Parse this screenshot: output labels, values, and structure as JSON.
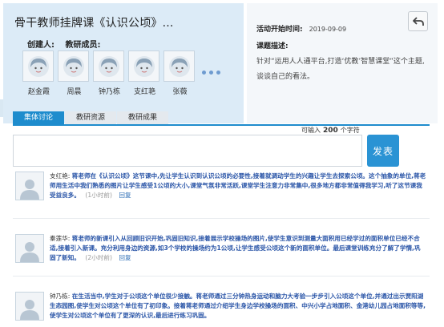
{
  "activity": {
    "title": "骨干教师挂牌课《认识公顷》...",
    "creator_label": "创建人:",
    "members_label": "教研成员:",
    "members": [
      {
        "name": "赵金霞"
      },
      {
        "name": "周晨"
      },
      {
        "name": "钟乃栋"
      },
      {
        "name": "支红艳"
      },
      {
        "name": "张薇"
      }
    ]
  },
  "info": {
    "time_label": "活动开始时间:",
    "time_value": "2019-09-09",
    "desc_label": "课题描述:",
    "description": "针对“运用人人通平台,打造‘优教’智慧课堂”这个主题,谈谈自己的看法。"
  },
  "tabs": [
    {
      "label": "集体讨论",
      "active": true
    },
    {
      "label": "教研资源",
      "active": false
    },
    {
      "label": "教研成果",
      "active": false
    }
  ],
  "composer": {
    "counter_prefix": "可输入",
    "counter_value": "200",
    "counter_suffix": "个字符",
    "send_label": "发表"
  },
  "posts": [
    {
      "author": "支红艳:",
      "body": "蒋老师在《认识公顷》这节课中,先让学生认识到认识公顷的必要性,接着就调动学生的兴趣让学生去探索公顷。这个抽象的单位,蒋老师用生活中我们熟悉的图片让学生感受1公顷的大小,课堂气氛非常活跃,课堂学生注意力非常集中,很多地方都非常值得我学习,听了这节课我受益良多。",
      "time": "(1小时前)",
      "reply": "回复"
    },
    {
      "author": "秦莲华:",
      "body": "蒋老师的新课引入从回顾旧识开始,巩固旧知识,接着展示学校操场的图片,使学生意识到测量大面积用已经学过的面积单位已经不合适,接着引入新课。充分利用身边的资源,如3个学校的操场约为1公顷,让学生感受公顷这个新的面积单位。最后课堂训练充分了解了学情,巩固了新知。",
      "time": "(2小时前)",
      "reply": "回复"
    },
    {
      "author": "钟乃栋:",
      "body": "在生活当中,学生对于公顷这个单位很少接触。蒋老师通过三分钟热身运动和脑力大考验一步步引入公顷这个单位,并通过出示贾阳湖生态园图,使学生对公顷这个单位有了初印象。接着蒋老师通过介绍学生身边学校操场的面积、中兴小学占地面积、金港幼儿园占地面积等等,使学生对公顷这个单位有了更深的认识,最后进行练习巩固。",
      "time": "",
      "reply": ""
    }
  ],
  "colors": {
    "accent": "#1e8ccd",
    "hero_bg": "#dcebf7",
    "post_text": "#2b56a8"
  }
}
